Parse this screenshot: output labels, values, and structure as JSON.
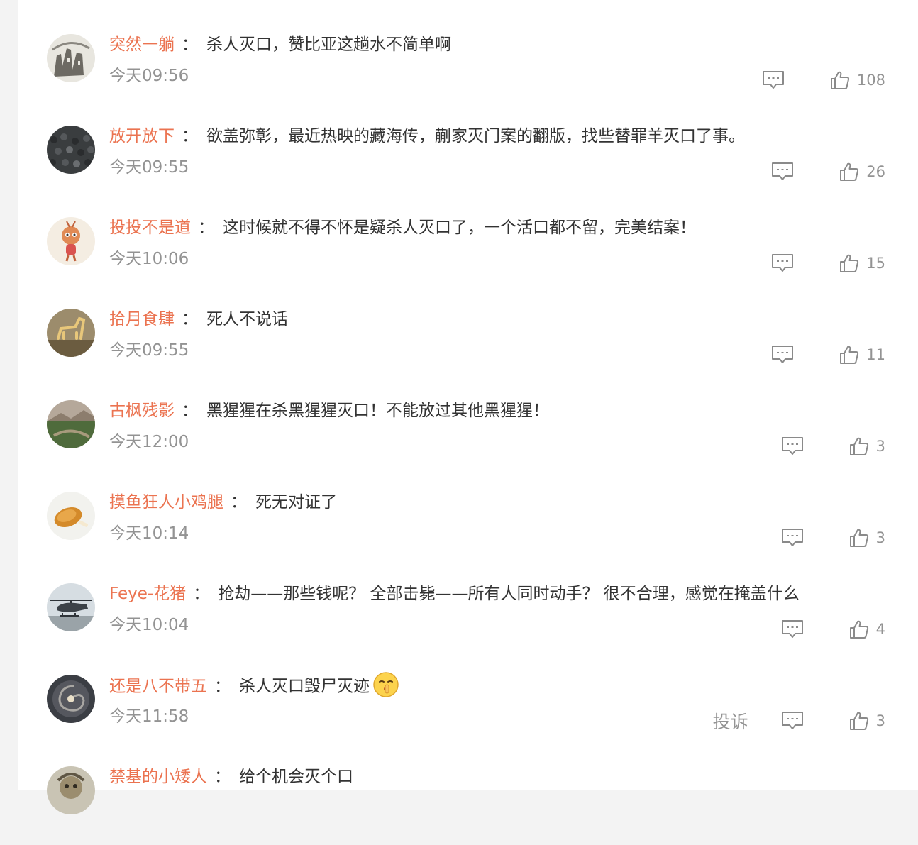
{
  "comments": [
    {
      "user": "突然一躺",
      "text": "杀人灭口，赞比亚这趟水不简单啊",
      "time": "今天09:56",
      "likes": "108",
      "avatar": "city-sketch-avatar"
    },
    {
      "user": "放开放下",
      "text": "欲盖弥彰，最近热映的藏海传，蒯家灭门案的翻版，找些替罪羊灭口了事。",
      "time": "今天09:55",
      "likes": "26",
      "avatar": "crowd-avatar"
    },
    {
      "user": "投投不是道",
      "text": "这时候就不得不怀是疑杀人灭口了，一个活口都不留，完美结案！",
      "time": "今天10:06",
      "likes": "15",
      "avatar": "monkey-cartoon-avatar"
    },
    {
      "user": "拾月食肆",
      "text": "死人不说话",
      "time": "今天09:55",
      "likes": "11",
      "avatar": "horse-sculpture-avatar"
    },
    {
      "user": "古枫残影",
      "text": "黑猩猩在杀黑猩猩灭口！不能放过其他黑猩猩！",
      "time": "今天12:00",
      "likes": "3",
      "avatar": "landscape-avatar"
    },
    {
      "user": "摸鱼狂人小鸡腿",
      "text": "死无对证了",
      "time": "今天10:14",
      "likes": "3",
      "avatar": "chicken-leg-avatar"
    },
    {
      "user": "Feye-花猪",
      "text": "抢劫——那些钱呢？ 全部击毙——所有人同时动手？ 很不合理，感觉在掩盖什么",
      "time": "今天10:04",
      "likes": "4",
      "avatar": "helicopter-avatar"
    },
    {
      "user": "还是八不带五",
      "text": "杀人灭口毁尸灭迹",
      "time": "今天11:58",
      "likes": "3",
      "avatar": "galaxy-avatar",
      "emoji": "shush-emoji",
      "report_label": "投诉"
    },
    {
      "user": "禁基的小矮人",
      "text": "给个机会灭个口",
      "time": "",
      "likes": "",
      "avatar": "dwarf-avatar"
    }
  ],
  "separator": "：",
  "colors": {
    "username": "#eb7350",
    "text": "#333333",
    "meta": "#939393"
  }
}
